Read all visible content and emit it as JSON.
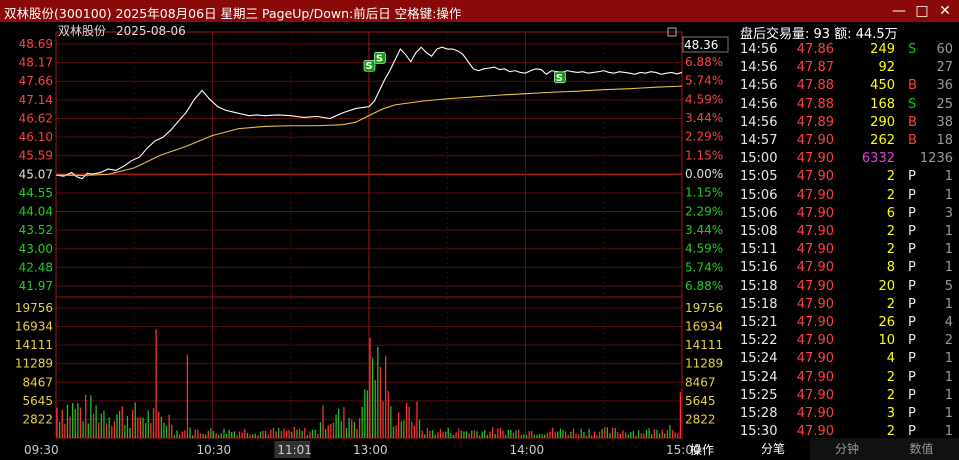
{
  "window": {
    "title": "双林股份(300100)  2025年08月06日  星期三  PageUp/Down:前后日  空格键:操作",
    "buttons": [
      "—",
      "□",
      "✕"
    ]
  },
  "chart_header": {
    "stock_name": "双林股份",
    "date": "2025-08-06",
    "current_price_label": "48.36"
  },
  "chart_data": {
    "type": "line",
    "price_ticks": [
      "48.69",
      "48.17",
      "47.66",
      "47.14",
      "46.62",
      "46.10",
      "45.59",
      "45.07",
      "44.55",
      "44.04",
      "43.52",
      "43.00",
      "42.48",
      "41.97"
    ],
    "pct_ticks": [
      "6.88%",
      "5.74%",
      "4.59%",
      "3.44%",
      "2.29%",
      "1.15%",
      "0.00%",
      "1.15%",
      "2.29%",
      "3.44%",
      "4.59%",
      "5.74%",
      "6.88%"
    ],
    "volume_ticks": [
      "19756",
      "16934",
      "14111",
      "11289",
      "8467",
      "5645",
      "2822"
    ],
    "time_labels": [
      "09:30",
      "10:30",
      "11:01",
      "13:00",
      "14:00",
      "15:00"
    ],
    "highlighted_time": "11:01",
    "price_range": [
      41.97,
      48.69
    ],
    "prev_close": 45.07,
    "volume_range": [
      0,
      22578
    ],
    "markers": [
      "S",
      "S",
      "S"
    ],
    "series": [
      {
        "color": "#ffffff",
        "x": [
          0,
          3,
          6,
          8,
          10,
          12,
          14,
          17,
          20,
          23,
          26,
          29,
          32,
          35,
          38,
          41,
          44,
          47,
          50,
          53,
          56,
          59,
          62,
          65,
          68,
          71,
          74,
          77,
          80,
          85,
          90,
          95,
          100,
          105,
          110,
          115,
          120,
          122,
          124,
          126,
          128,
          130,
          132,
          134,
          136,
          138,
          140,
          142,
          144,
          146,
          148,
          150,
          152,
          154,
          156,
          158,
          160,
          162,
          164,
          166,
          168,
          170,
          172,
          174,
          176,
          178,
          180,
          182,
          184,
          186,
          188,
          190,
          192,
          194,
          196,
          198,
          200,
          202,
          204,
          206,
          208,
          210,
          212,
          214,
          216,
          218,
          220,
          222,
          224,
          226,
          228,
          230,
          232,
          234,
          236,
          238,
          239,
          240
        ],
        "y": [
          45.05,
          45.02,
          45.12,
          45.0,
          44.95,
          45.1,
          45.08,
          45.12,
          45.22,
          45.18,
          45.3,
          45.45,
          45.55,
          45.8,
          46.0,
          46.1,
          46.3,
          46.55,
          46.8,
          47.15,
          47.4,
          47.15,
          46.95,
          46.85,
          46.8,
          46.75,
          46.7,
          46.72,
          46.7,
          46.72,
          46.7,
          46.65,
          46.68,
          46.62,
          46.78,
          46.9,
          46.95,
          47.1,
          47.4,
          47.7,
          47.95,
          48.25,
          48.55,
          48.4,
          48.2,
          48.45,
          48.6,
          48.45,
          48.35,
          48.55,
          48.6,
          48.55,
          48.55,
          48.5,
          48.4,
          48.2,
          48.0,
          47.95,
          48.0,
          48.02,
          48.05,
          47.98,
          48.0,
          47.92,
          47.95,
          47.9,
          47.88,
          47.95,
          48.0,
          47.98,
          47.85,
          47.95,
          47.92,
          47.9,
          47.95,
          47.92,
          47.9,
          47.92,
          47.88,
          47.9,
          47.92,
          47.95,
          47.9,
          47.88,
          47.92,
          47.9,
          47.88,
          47.85,
          47.9,
          47.88,
          47.92,
          47.9,
          47.85,
          47.88,
          47.9,
          47.86,
          47.88,
          47.9
        ]
      },
      {
        "color": "#e6c24a",
        "x": [
          0,
          10,
          20,
          30,
          40,
          50,
          60,
          70,
          80,
          90,
          100,
          110,
          115,
          120,
          125,
          130,
          140,
          150,
          160,
          170,
          180,
          190,
          200,
          210,
          220,
          230,
          240
        ],
        "y": [
          45.05,
          45.04,
          45.07,
          45.25,
          45.6,
          45.85,
          46.15,
          46.34,
          46.4,
          46.42,
          46.42,
          46.45,
          46.52,
          46.7,
          46.88,
          47.0,
          47.1,
          47.17,
          47.22,
          47.27,
          47.31,
          47.35,
          47.38,
          47.42,
          47.45,
          47.49,
          47.52
        ]
      }
    ]
  },
  "trades": {
    "summary": "盘后交易量: 93  额: 44.5万",
    "rows": [
      {
        "time": "14:56",
        "price": "47.86",
        "vol": "249",
        "flag": "S",
        "cnt": "60"
      },
      {
        "time": "14:56",
        "price": "47.87",
        "vol": "92",
        "flag": "",
        "cnt": "27"
      },
      {
        "time": "14:56",
        "price": "47.88",
        "vol": "450",
        "flag": "B",
        "cnt": "36"
      },
      {
        "time": "14:56",
        "price": "47.88",
        "vol": "168",
        "flag": "S",
        "cnt": "25"
      },
      {
        "time": "14:56",
        "price": "47.89",
        "vol": "290",
        "flag": "B",
        "cnt": "38"
      },
      {
        "time": "14:57",
        "price": "47.90",
        "vol": "262",
        "flag": "B",
        "cnt": "18"
      },
      {
        "time": "15:00",
        "price": "47.90",
        "vol": "6332",
        "flag": "",
        "cnt": "1236"
      },
      {
        "time": "15:05",
        "price": "47.90",
        "vol": "2",
        "flag": "P",
        "cnt": "1"
      },
      {
        "time": "15:06",
        "price": "47.90",
        "vol": "2",
        "flag": "P",
        "cnt": "1"
      },
      {
        "time": "15:06",
        "price": "47.90",
        "vol": "6",
        "flag": "P",
        "cnt": "3"
      },
      {
        "time": "15:08",
        "price": "47.90",
        "vol": "2",
        "flag": "P",
        "cnt": "1"
      },
      {
        "time": "15:11",
        "price": "47.90",
        "vol": "2",
        "flag": "P",
        "cnt": "1"
      },
      {
        "time": "15:16",
        "price": "47.90",
        "vol": "8",
        "flag": "P",
        "cnt": "1"
      },
      {
        "time": "15:18",
        "price": "47.90",
        "vol": "20",
        "flag": "P",
        "cnt": "5"
      },
      {
        "time": "15:18",
        "price": "47.90",
        "vol": "2",
        "flag": "P",
        "cnt": "1"
      },
      {
        "time": "15:21",
        "price": "47.90",
        "vol": "26",
        "flag": "P",
        "cnt": "4"
      },
      {
        "time": "15:22",
        "price": "47.90",
        "vol": "10",
        "flag": "P",
        "cnt": "2"
      },
      {
        "time": "15:24",
        "price": "47.90",
        "vol": "4",
        "flag": "P",
        "cnt": "1"
      },
      {
        "time": "15:24",
        "price": "47.90",
        "vol": "2",
        "flag": "P",
        "cnt": "1"
      },
      {
        "time": "15:25",
        "price": "47.90",
        "vol": "2",
        "flag": "P",
        "cnt": "1"
      },
      {
        "time": "15:28",
        "price": "47.90",
        "vol": "3",
        "flag": "P",
        "cnt": "1"
      },
      {
        "time": "15:30",
        "price": "47.90",
        "vol": "2",
        "flag": "P",
        "cnt": "1"
      }
    ]
  },
  "flag_colors": {
    "S": "#00d000",
    "B": "#ff4040",
    "P": "#e8e8e8"
  },
  "tabs": [
    "分笔",
    "分钟",
    "数值"
  ],
  "axis_button": "操作"
}
